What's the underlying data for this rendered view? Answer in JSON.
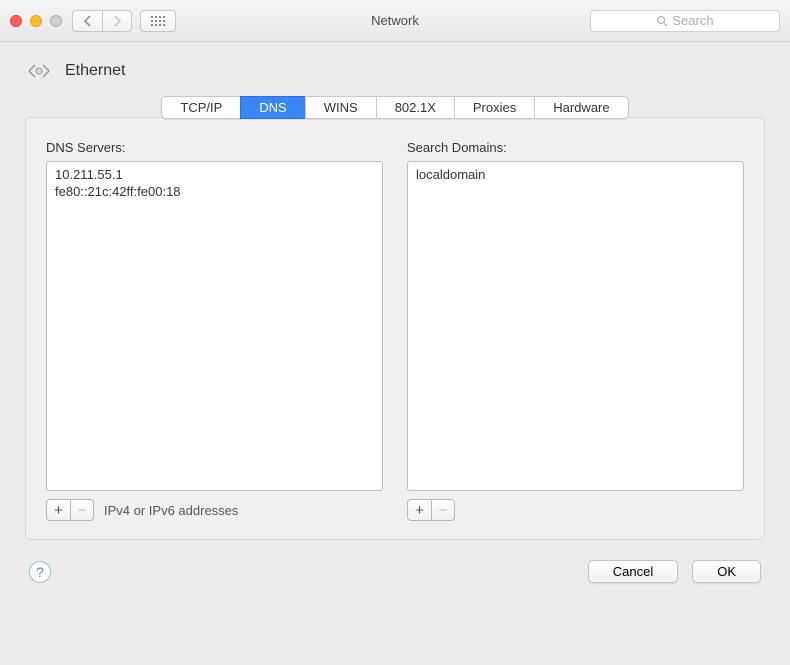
{
  "window": {
    "title": "Network",
    "search_placeholder": "Search"
  },
  "header": {
    "interface_label": "Ethernet"
  },
  "tabs": {
    "items": [
      "TCP/IP",
      "DNS",
      "WINS",
      "802.1X",
      "Proxies",
      "Hardware"
    ],
    "active_index": 1
  },
  "dns_panel": {
    "dns_label": "DNS Servers:",
    "dns_entries": [
      "10.211.55.1",
      "fe80::21c:42ff:fe00:18"
    ],
    "dns_hint": "IPv4 or IPv6 addresses",
    "domains_label": "Search Domains:",
    "domains_entries": [
      "localdomain"
    ]
  },
  "buttons": {
    "plus": "+",
    "minus": "−",
    "help": "?",
    "cancel": "Cancel",
    "ok": "OK"
  }
}
